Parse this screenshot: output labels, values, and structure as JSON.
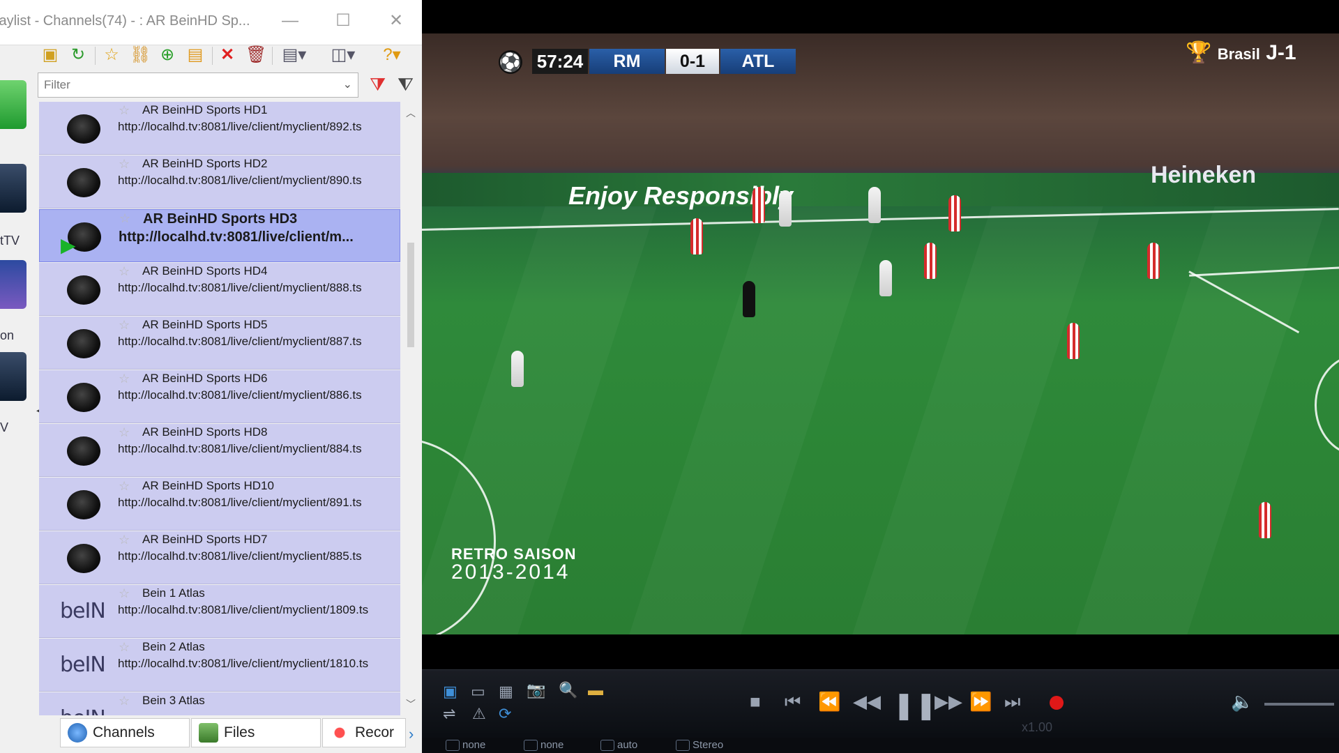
{
  "playlist": {
    "title": "laylist - Channels(74) - : AR  BeinHD Sp...",
    "window_controls": {
      "minimize": "—",
      "maximize": "☐",
      "close": "✕"
    },
    "filter_placeholder": "Filter",
    "dock_labels": [
      "tTV",
      "on",
      "V"
    ],
    "channels": [
      {
        "name": "AR  BeinHD Sports HD1",
        "url": "http://localhd.tv:8081/live/client/myclient/892.ts",
        "logo": "dark-globe"
      },
      {
        "name": "AR  BeinHD Sports HD2",
        "url": "http://localhd.tv:8081/live/client/myclient/890.ts",
        "logo": "dark-globe"
      },
      {
        "name": "AR  BeinHD Sports HD3",
        "url": "http://localhd.tv:8081/live/client/m...",
        "logo": "dark-globe",
        "selected": true,
        "playing": true
      },
      {
        "name": "AR  BeinHD Sports HD4",
        "url": "http://localhd.tv:8081/live/client/myclient/888.ts",
        "logo": "dark-globe"
      },
      {
        "name": "AR  BeinHD Sports HD5",
        "url": "http://localhd.tv:8081/live/client/myclient/887.ts",
        "logo": "dark-globe"
      },
      {
        "name": "AR  BeinHD Sports HD6",
        "url": "http://localhd.tv:8081/live/client/myclient/886.ts",
        "logo": "dark-globe"
      },
      {
        "name": "AR  BeinHD Sports HD8",
        "url": "http://localhd.tv:8081/live/client/myclient/884.ts",
        "logo": "dark-globe"
      },
      {
        "name": "AR BeinHD Sports HD10",
        "url": "http://localhd.tv:8081/live/client/myclient/891.ts",
        "logo": "dark-globe"
      },
      {
        "name": "AR BeinHD Sports HD7",
        "url": "http://localhd.tv:8081/live/client/myclient/885.ts",
        "logo": "dark-globe"
      },
      {
        "name": "Bein 1 Atlas",
        "url": "http://localhd.tv:8081/live/client/myclient/1809.ts",
        "logo": "bein"
      },
      {
        "name": "Bein 2 Atlas",
        "url": "http://localhd.tv:8081/live/client/myclient/1810.ts",
        "logo": "bein"
      },
      {
        "name": "Bein 3 Atlas",
        "url": "",
        "logo": "bein"
      }
    ],
    "bein_logo_text": "beIN",
    "tabs": [
      {
        "label": "Channels",
        "icon": "globe-icon"
      },
      {
        "label": "Files",
        "icon": "files-icon"
      },
      {
        "label": "Recor",
        "icon": "record-icon"
      }
    ]
  },
  "video": {
    "scoreboard": {
      "time": "57:24",
      "home": "RM",
      "score": "0-1",
      "away": "ATL"
    },
    "ad_text_left": "Enjoy Responsibly",
    "ad_text_right": "Heineken",
    "badge_text": "Brasil",
    "badge_suffix": "J-1",
    "retro_line1": "RETRO SAISON",
    "retro_line2": "2013-2014"
  },
  "controls": {
    "speed": "x1.00",
    "status": [
      "none",
      "none",
      "auto",
      "Stereo"
    ]
  }
}
